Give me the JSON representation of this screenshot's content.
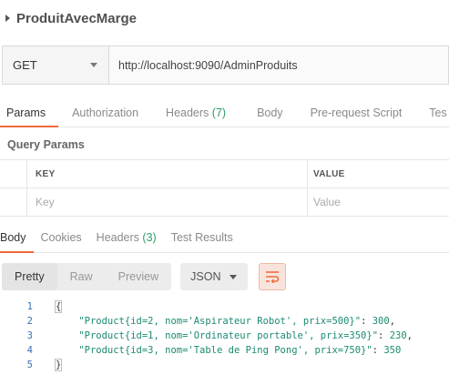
{
  "request": {
    "name": "ProduitAvecMarge",
    "method": "GET",
    "url": "http://localhost:9090/AdminProduits"
  },
  "request_tabs": [
    {
      "label": "Params",
      "count": ""
    },
    {
      "label": "Authorization",
      "count": ""
    },
    {
      "label": "Headers",
      "count": "(7)"
    },
    {
      "label": "Body",
      "count": ""
    },
    {
      "label": "Pre-request Script",
      "count": ""
    },
    {
      "label": "Tes",
      "count": ""
    }
  ],
  "query_params": {
    "title": "Query Params",
    "columns": [
      "KEY",
      "VALUE"
    ],
    "placeholders": {
      "key": "Key",
      "value": "Value"
    }
  },
  "response_tabs": [
    {
      "label": "Body",
      "count": ""
    },
    {
      "label": "Cookies",
      "count": ""
    },
    {
      "label": "Headers",
      "count": "(3)"
    },
    {
      "label": "Test Results",
      "count": ""
    }
  ],
  "response_toolbar": {
    "views": [
      "Pretty",
      "Raw",
      "Preview"
    ],
    "format": "JSON"
  },
  "response_body": {
    "line_numbers": [
      "1",
      "2",
      "3",
      "4",
      "5"
    ],
    "open_brace": "{",
    "close_brace": "}",
    "entries": [
      {
        "key": "\"Product{id=2, nom='Aspirateur Robot', prix=500}\"",
        "value": "300",
        "sep": ","
      },
      {
        "key": "\"Product{id=1, nom='Ordinateur portable', prix=350}\"",
        "value": "230",
        "sep": ","
      },
      {
        "key": "\"Product{id=3, nom='Table de Ping Pong', prix=750}\"",
        "value": "350",
        "sep": ""
      }
    ]
  },
  "colors": {
    "accent": "#f26b3a",
    "count_green": "#2d9d63",
    "json_value": "#1b8a72",
    "line_number": "#3a6db5"
  }
}
